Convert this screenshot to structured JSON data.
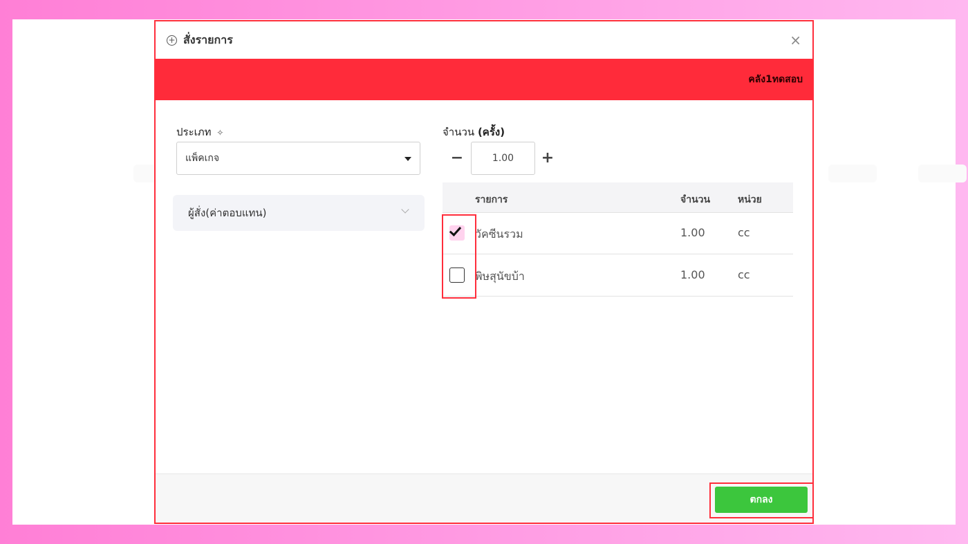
{
  "modal": {
    "title": "สั่งรายการ",
    "close_symbol": "×",
    "warehouse_name": "คลัง1ทดสอบ"
  },
  "form": {
    "type_label": "ประเภท",
    "type_selected": "แพ็คเกจ",
    "orderer_label": "ผู้สั่ง(ค่าตอบแทน)",
    "quantity_label": "จำนวน",
    "quantity_label_suffix": "(ครั้ง)",
    "quantity_value": "1.00",
    "minus_symbol": "−",
    "plus_symbol": "+"
  },
  "table": {
    "headers": {
      "name": "รายการ",
      "quantity": "จำนวน",
      "unit": "หน่วย"
    },
    "rows": [
      {
        "name": "วัคซีนรวม",
        "quantity": "1.00",
        "unit": "cc",
        "checked": true
      },
      {
        "name": "พิษสุนัขบ้า",
        "quantity": "1.00",
        "unit": "cc",
        "checked": false
      }
    ]
  },
  "footer": {
    "ok_label": "ตกลง"
  },
  "colors": {
    "accent_red": "#ff2b3a",
    "ok_green": "#3cc63d",
    "checked_bg": "#ffd3ee"
  },
  "icons": {
    "header": "plus-circle-icon",
    "type_label": "sparkle-icon",
    "select": "caret-down-icon",
    "accordion": "chevron-down-icon",
    "checkbox": "check-icon"
  }
}
